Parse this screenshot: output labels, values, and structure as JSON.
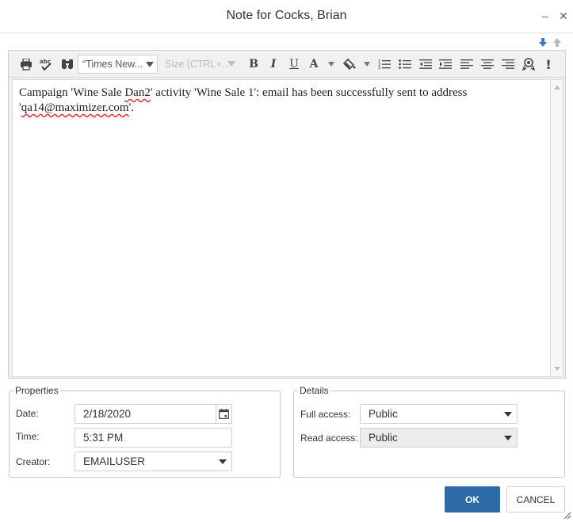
{
  "window": {
    "title": "Note for Cocks, Brian",
    "minimize": "–",
    "close": "✕"
  },
  "toolbar": {
    "font_name": "“Times New...",
    "font_size_placeholder": "Size (CTRL+...",
    "bold": "B",
    "italic": "I",
    "underline": "U",
    "font_color": "A"
  },
  "note": {
    "text_part1": "Campaign 'Wine Sale ",
    "text_misspelled1": "Dan2",
    "text_part2": "' activity 'Wine Sale 1': email has been successfully sent to address '",
    "text_misspelled2": "qa14@maximizer.com",
    "text_part3": "'."
  },
  "properties": {
    "legend": "Properties",
    "date_label": "Date:",
    "date_value": "2/18/2020",
    "time_label": "Time:",
    "time_value": "5:31 PM",
    "creator_label": "Creator:",
    "creator_value": "EMAILUSER"
  },
  "details": {
    "legend": "Details",
    "full_access_label": "Full access:",
    "full_access_value": "Public",
    "read_access_label": "Read access:",
    "read_access_value": "Public"
  },
  "buttons": {
    "ok": "OK",
    "cancel": "CANCEL"
  },
  "colors": {
    "primary": "#2d6aa7",
    "nav_arrow_active": "#3a78c9"
  }
}
